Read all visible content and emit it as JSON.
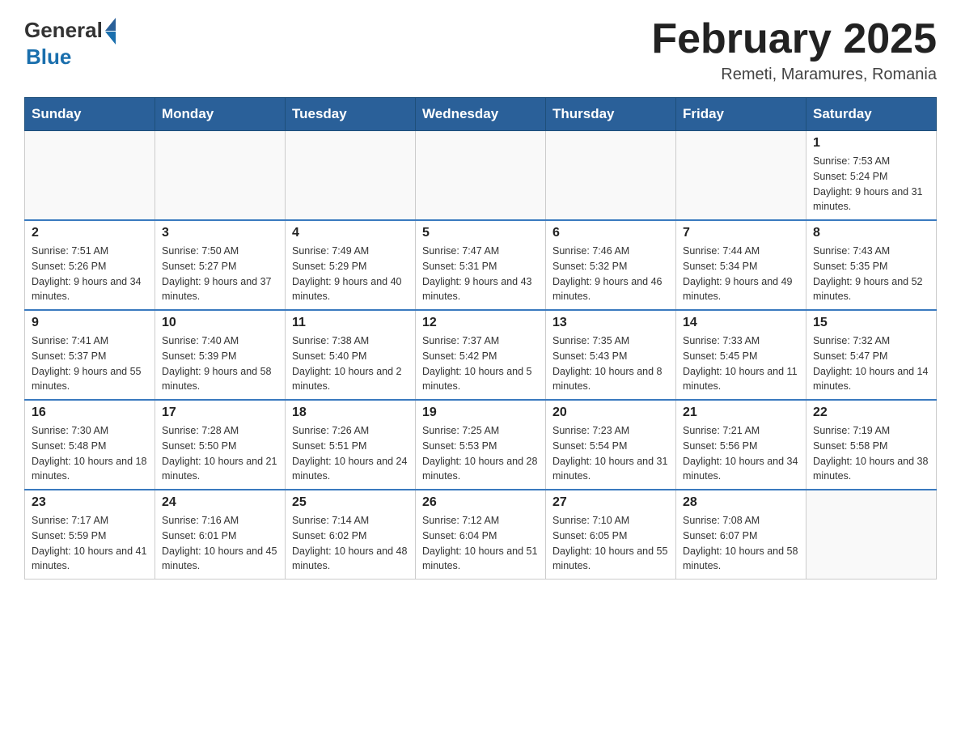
{
  "header": {
    "logo": {
      "general": "General",
      "blue": "Blue"
    },
    "title": "February 2025",
    "location": "Remeti, Maramures, Romania"
  },
  "days_of_week": [
    "Sunday",
    "Monday",
    "Tuesday",
    "Wednesday",
    "Thursday",
    "Friday",
    "Saturday"
  ],
  "weeks": [
    [
      {
        "day": "",
        "info": ""
      },
      {
        "day": "",
        "info": ""
      },
      {
        "day": "",
        "info": ""
      },
      {
        "day": "",
        "info": ""
      },
      {
        "day": "",
        "info": ""
      },
      {
        "day": "",
        "info": ""
      },
      {
        "day": "1",
        "info": "Sunrise: 7:53 AM\nSunset: 5:24 PM\nDaylight: 9 hours and 31 minutes."
      }
    ],
    [
      {
        "day": "2",
        "info": "Sunrise: 7:51 AM\nSunset: 5:26 PM\nDaylight: 9 hours and 34 minutes."
      },
      {
        "day": "3",
        "info": "Sunrise: 7:50 AM\nSunset: 5:27 PM\nDaylight: 9 hours and 37 minutes."
      },
      {
        "day": "4",
        "info": "Sunrise: 7:49 AM\nSunset: 5:29 PM\nDaylight: 9 hours and 40 minutes."
      },
      {
        "day": "5",
        "info": "Sunrise: 7:47 AM\nSunset: 5:31 PM\nDaylight: 9 hours and 43 minutes."
      },
      {
        "day": "6",
        "info": "Sunrise: 7:46 AM\nSunset: 5:32 PM\nDaylight: 9 hours and 46 minutes."
      },
      {
        "day": "7",
        "info": "Sunrise: 7:44 AM\nSunset: 5:34 PM\nDaylight: 9 hours and 49 minutes."
      },
      {
        "day": "8",
        "info": "Sunrise: 7:43 AM\nSunset: 5:35 PM\nDaylight: 9 hours and 52 minutes."
      }
    ],
    [
      {
        "day": "9",
        "info": "Sunrise: 7:41 AM\nSunset: 5:37 PM\nDaylight: 9 hours and 55 minutes."
      },
      {
        "day": "10",
        "info": "Sunrise: 7:40 AM\nSunset: 5:39 PM\nDaylight: 9 hours and 58 minutes."
      },
      {
        "day": "11",
        "info": "Sunrise: 7:38 AM\nSunset: 5:40 PM\nDaylight: 10 hours and 2 minutes."
      },
      {
        "day": "12",
        "info": "Sunrise: 7:37 AM\nSunset: 5:42 PM\nDaylight: 10 hours and 5 minutes."
      },
      {
        "day": "13",
        "info": "Sunrise: 7:35 AM\nSunset: 5:43 PM\nDaylight: 10 hours and 8 minutes."
      },
      {
        "day": "14",
        "info": "Sunrise: 7:33 AM\nSunset: 5:45 PM\nDaylight: 10 hours and 11 minutes."
      },
      {
        "day": "15",
        "info": "Sunrise: 7:32 AM\nSunset: 5:47 PM\nDaylight: 10 hours and 14 minutes."
      }
    ],
    [
      {
        "day": "16",
        "info": "Sunrise: 7:30 AM\nSunset: 5:48 PM\nDaylight: 10 hours and 18 minutes."
      },
      {
        "day": "17",
        "info": "Sunrise: 7:28 AM\nSunset: 5:50 PM\nDaylight: 10 hours and 21 minutes."
      },
      {
        "day": "18",
        "info": "Sunrise: 7:26 AM\nSunset: 5:51 PM\nDaylight: 10 hours and 24 minutes."
      },
      {
        "day": "19",
        "info": "Sunrise: 7:25 AM\nSunset: 5:53 PM\nDaylight: 10 hours and 28 minutes."
      },
      {
        "day": "20",
        "info": "Sunrise: 7:23 AM\nSunset: 5:54 PM\nDaylight: 10 hours and 31 minutes."
      },
      {
        "day": "21",
        "info": "Sunrise: 7:21 AM\nSunset: 5:56 PM\nDaylight: 10 hours and 34 minutes."
      },
      {
        "day": "22",
        "info": "Sunrise: 7:19 AM\nSunset: 5:58 PM\nDaylight: 10 hours and 38 minutes."
      }
    ],
    [
      {
        "day": "23",
        "info": "Sunrise: 7:17 AM\nSunset: 5:59 PM\nDaylight: 10 hours and 41 minutes."
      },
      {
        "day": "24",
        "info": "Sunrise: 7:16 AM\nSunset: 6:01 PM\nDaylight: 10 hours and 45 minutes."
      },
      {
        "day": "25",
        "info": "Sunrise: 7:14 AM\nSunset: 6:02 PM\nDaylight: 10 hours and 48 minutes."
      },
      {
        "day": "26",
        "info": "Sunrise: 7:12 AM\nSunset: 6:04 PM\nDaylight: 10 hours and 51 minutes."
      },
      {
        "day": "27",
        "info": "Sunrise: 7:10 AM\nSunset: 6:05 PM\nDaylight: 10 hours and 55 minutes."
      },
      {
        "day": "28",
        "info": "Sunrise: 7:08 AM\nSunset: 6:07 PM\nDaylight: 10 hours and 58 minutes."
      },
      {
        "day": "",
        "info": ""
      }
    ]
  ]
}
